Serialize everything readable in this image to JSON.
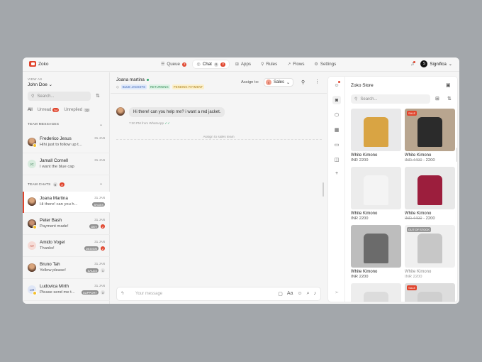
{
  "brand": {
    "name": "Zoko"
  },
  "nav": {
    "tabs": [
      {
        "label": "Queue",
        "badge": "2"
      },
      {
        "label": "Chat",
        "badge_a": "6",
        "badge_b": "2"
      },
      {
        "label": "Apps"
      },
      {
        "label": "Rules"
      },
      {
        "label": "Flows"
      },
      {
        "label": "Settings"
      }
    ],
    "org": "Significa",
    "org_initial": "S"
  },
  "left": {
    "view_as_label": "VIEW AS",
    "view_as_user": "John Doe",
    "search_placeholder": "Search...",
    "filters": [
      {
        "label": "All"
      },
      {
        "label": "Unread",
        "badge": "54"
      },
      {
        "label": "Unreplied",
        "badge": "32"
      }
    ],
    "team_messages_label": "TEAM MESSAGES",
    "team_chats_label": "TEAM CHATS",
    "team_chats_badge_a": "6",
    "team_chats_badge_b": "2",
    "team_messages": [
      {
        "name": "Frederico Jesus",
        "msg": "Hihi just to follow up t...",
        "date": "31 JAN"
      },
      {
        "name": "Jamall Cornell",
        "initials": "JC",
        "msg": "I want the blue cap",
        "date": "31 JAN"
      }
    ],
    "team_chats": [
      {
        "name": "Joana Martina",
        "msg": "Hi there! can you h...",
        "date": "31 JAN",
        "tag": "SALES"
      },
      {
        "name": "Peter Bash",
        "msg": "Payment made!",
        "date": "31 JAN",
        "tag": "DEV",
        "badge": "2"
      },
      {
        "name": "Amido Vogel",
        "initials": "AV",
        "msg": "Thanks!",
        "date": "31 JAN",
        "tag": "DESIGN",
        "badge": "2"
      },
      {
        "name": "Bruno Tah",
        "msg": "Yellow please!",
        "date": "31 JAN",
        "tag": "SALES",
        "badge": "1"
      },
      {
        "name": "Ludovica Mirth",
        "initials": "LM",
        "msg": "Please send me t...",
        "date": "31 JAN",
        "tag": "SUPPORT",
        "badge": "3"
      }
    ]
  },
  "chat": {
    "contact": "Joana martina",
    "tags": [
      "BLUE JACKETS",
      "RETURNING",
      "PENDING PAYMENT"
    ],
    "assign_label": "Assign to:",
    "assignee": "Sales",
    "assignee_initial": "S",
    "message": "Hi there! can you help me? i want a red jacket.",
    "message_meta": "7:20 PM from WhatsApp",
    "system_note": "Assign to sales team",
    "composer_placeholder": "Your message"
  },
  "store": {
    "title": "Zoko Store",
    "search_placeholder": "Search...",
    "products": [
      {
        "name": "White Kimono",
        "price": "INR 2200",
        "img": "#e9e9ea",
        "obj": "#d9a443"
      },
      {
        "name": "White Kimono",
        "old_price": "INR 4400",
        "price": "- 2200",
        "sale": "SALE",
        "img": "#b8a58f",
        "obj": "#2b2b2b"
      },
      {
        "name": "White Kimono",
        "price": "INR 2200",
        "img": "#ececec",
        "obj": "#f4f4f4"
      },
      {
        "name": "White Kimono",
        "old_price": "INR 4400",
        "price": "- 2200",
        "img": "#e8e8e8",
        "obj": "#9c1e3d"
      },
      {
        "name": "White Kimono",
        "price": "INR 2200",
        "img": "#bdbdbd",
        "obj": "#6b6b6b"
      },
      {
        "name": "White Kimono",
        "price": "INR 2200",
        "oos": "OUT OF STOCK",
        "img": "#e3e3e3",
        "obj": "#9a9a9a"
      },
      {
        "img": "#ededed",
        "obj": "#dcdcdc"
      },
      {
        "sale": "SALE",
        "img": "#dddddd",
        "obj": "#cfcfcf"
      }
    ]
  },
  "colors": {
    "accent": "#e0442c",
    "online": "#2ea86a"
  }
}
